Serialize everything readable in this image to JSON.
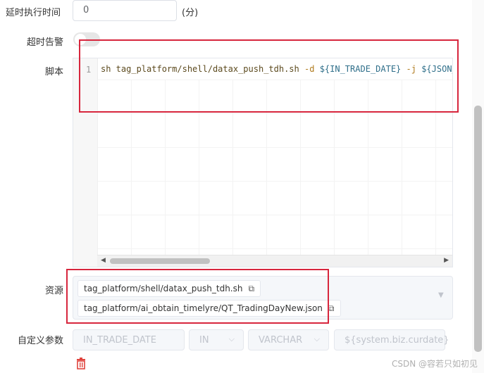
{
  "form": {
    "delay": {
      "label": "延时执行时间",
      "value": "0",
      "unit": "(分)"
    },
    "timeout_alarm": {
      "label": "超时告警",
      "enabled": false
    },
    "script": {
      "label": "脚本",
      "line_number": "1",
      "code": {
        "cmd": "sh tag_platform/shell/datax_push_tdh.sh",
        "flag_d": "-d",
        "var_trade_date": "${IN_TRADE_DATE}",
        "flag_j": "-j",
        "var_json": "${JSON_FI"
      }
    },
    "resources": {
      "label": "资源",
      "items": [
        "tag_platform/shell/datax_push_tdh.sh",
        "tag_platform/ai_obtain_timelyre/QT_TradingDayNew.json"
      ]
    },
    "custom_params": {
      "label": "自定义参数",
      "prop": "IN_TRADE_DATE",
      "direct": "IN",
      "type": "VARCHAR",
      "value": "${system.biz.curdate}"
    }
  },
  "watermark": "CSDN @容若只如初见",
  "colors": {
    "highlight_border": "#d7263d",
    "delete_icon": "#e0443e"
  }
}
